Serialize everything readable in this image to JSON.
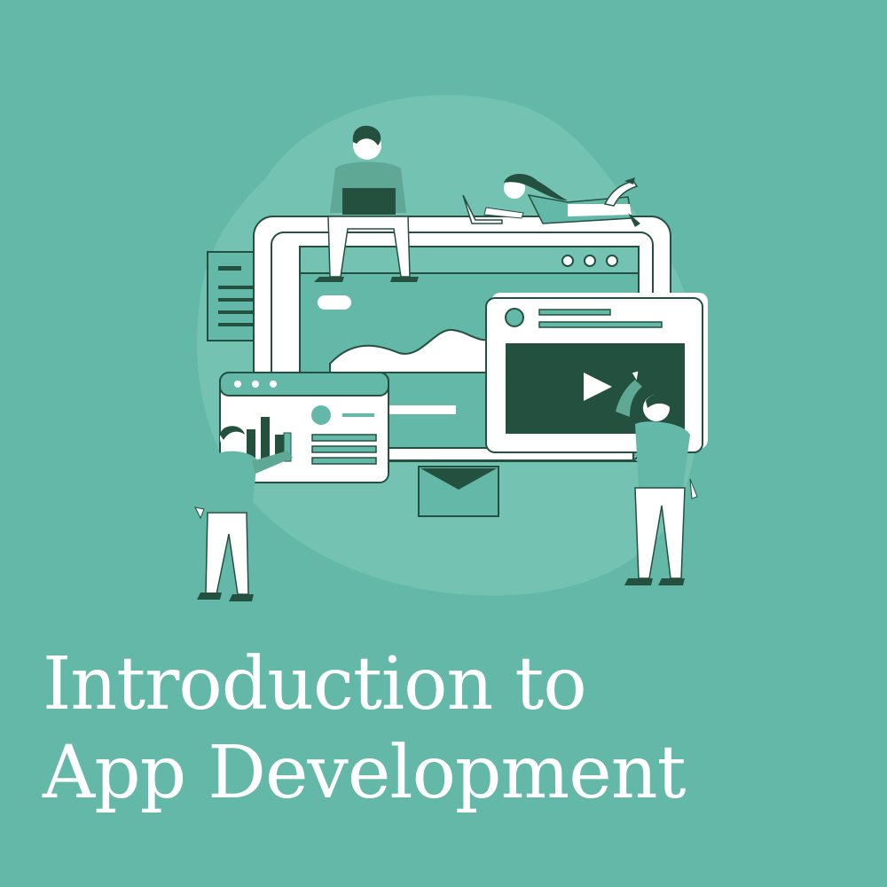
{
  "title": {
    "line1": "Introduction to",
    "line2": "App Development"
  },
  "colors": {
    "background": "#64B8A8",
    "blob": "#74C2B2",
    "dark": "#24503F",
    "white": "#FFFFFF",
    "shirt": "#5FA896"
  },
  "icons": {
    "video": "play-icon",
    "mail": "envelope-icon",
    "chart": "bar-chart-icon",
    "document": "document-icon"
  }
}
